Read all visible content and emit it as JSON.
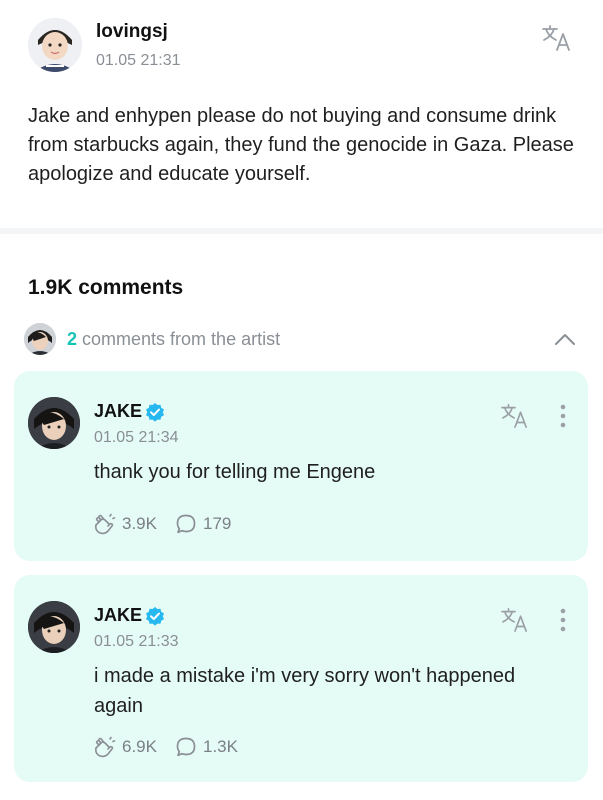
{
  "post": {
    "username": "lovingsj",
    "timestamp": "01.05 21:31",
    "body": "Jake and enhypen please do not buying and consume drink from starbucks again, they fund the genocide in Gaza. Please apologize and educate yourself.",
    "icons": {
      "avatar": "user-avatar",
      "translate": "translate-icon"
    }
  },
  "comments_header": {
    "count_label": "1.9K comments"
  },
  "artist_comments": {
    "count": "2",
    "label": "comments from the artist",
    "icons": {
      "toggle": "chevron-up-icon"
    }
  },
  "comments": [
    {
      "author": "JAKE",
      "verified": true,
      "timestamp": "01.05 21:34",
      "text": "thank you for telling me Engene",
      "likes": "3.9K",
      "replies": "179"
    },
    {
      "author": "JAKE",
      "verified": true,
      "timestamp": "01.05 21:33",
      "text": "i made a mistake i'm very sorry won't happened again",
      "likes": "6.9K",
      "replies": "1.3K"
    }
  ],
  "colors": {
    "accent": "#17c3b5",
    "card_background": "#e5fbf6",
    "verified_badge": "#27b8f0",
    "muted_text": "#8a8f95"
  }
}
